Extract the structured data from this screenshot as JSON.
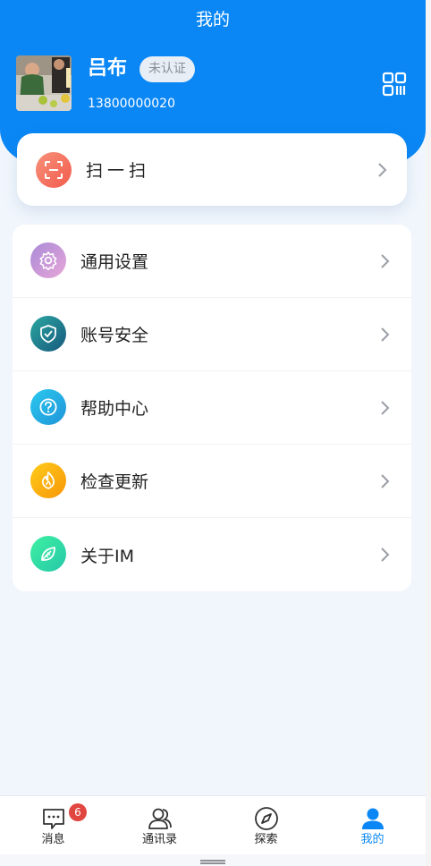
{
  "header": {
    "title": "我的"
  },
  "user": {
    "name": "吕布",
    "badge": "未认证",
    "phone": "13800000020"
  },
  "scan": {
    "label": "扫一扫",
    "icon": "scan-icon",
    "color": "#f47a66"
  },
  "menu": [
    {
      "label": "通用设置",
      "icon": "gear-icon",
      "color": "#c592dd"
    },
    {
      "label": "账号安全",
      "icon": "shield-icon",
      "color": "#1d8a9a"
    },
    {
      "label": "帮助中心",
      "icon": "help-icon",
      "color": "#1fb0e6"
    },
    {
      "label": "检查更新",
      "icon": "flame-icon",
      "color": "#fcae0e"
    },
    {
      "label": "关于IM",
      "icon": "leaf-icon",
      "color": "#3fe0a4"
    }
  ],
  "tabbar": {
    "tabs": [
      {
        "label": "消息",
        "icon": "message-icon"
      },
      {
        "label": "通讯录",
        "icon": "contacts-icon"
      },
      {
        "label": "探索",
        "icon": "compass-icon"
      },
      {
        "label": "我的",
        "icon": "profile-icon"
      }
    ],
    "active_tab": "我的",
    "message_badge": "6"
  },
  "colors": {
    "primary": "#0a87f5",
    "badge_red": "#e0453f"
  }
}
